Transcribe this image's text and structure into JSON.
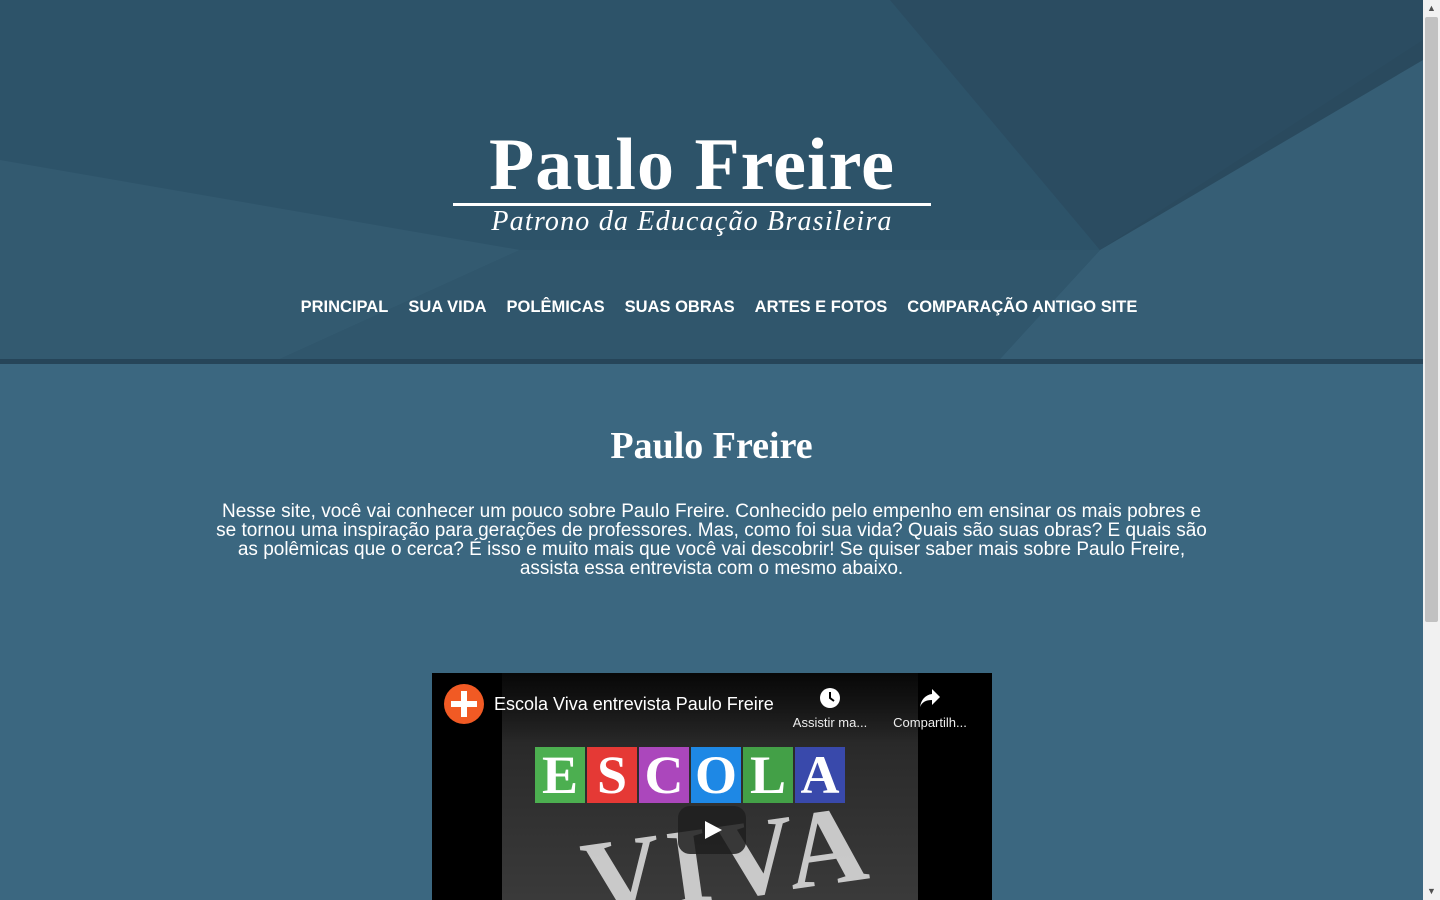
{
  "header": {
    "logo_title": "Paulo Freire",
    "logo_subtitle": "Patrono da Educação Brasileira",
    "nav": [
      {
        "label": "PRINCIPAL"
      },
      {
        "label": "SUA VIDA"
      },
      {
        "label": "POLÊMICAS"
      },
      {
        "label": "SUAS OBRAS"
      },
      {
        "label": "ARTES E FOTOS"
      },
      {
        "label": "COMPARAÇÃO ANTIGO SITE"
      }
    ]
  },
  "main": {
    "title": "Paulo Freire",
    "intro": "Nesse site, você vai conhecer um pouco sobre Paulo Freire. Conhecido pelo empenho em ensinar os mais pobres e se tornou uma inspiração para gerações de professores. Mas, como foi sua vida? Quais são suas obras? E quais são as polêmicas que o cerca? É isso e muito mais que você vai descobrir! Se quiser saber mais sobre Paulo Freire, assista essa entrevista com o mesmo abaixo."
  },
  "video": {
    "title": "Escola Viva entrevista Paulo Freire",
    "watch_later": "Assistir ma...",
    "share": "Compartilh...",
    "thumbnail_letters": [
      "E",
      "S",
      "C",
      "O",
      "L",
      "A"
    ],
    "thumbnail_word": "VIVA",
    "letter_colors": [
      "#4caf50",
      "#e53935",
      "#ab47bc",
      "#1e88e5",
      "#43a047",
      "#3949ab"
    ]
  },
  "colors": {
    "header_bg": "#2d5369",
    "content_bg": "#3b6780",
    "divider": "#264559"
  }
}
